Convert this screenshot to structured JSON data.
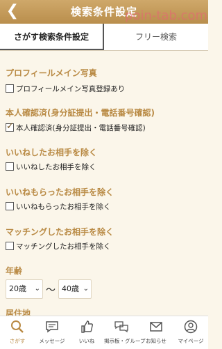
{
  "header": {
    "title": "検索条件設定",
    "watermark": "poin-tab.com"
  },
  "tabs": [
    {
      "label": "さがす検索条件設定",
      "active": true
    },
    {
      "label": "フリー検索",
      "active": false
    }
  ],
  "sections": [
    {
      "title": "プロフィールメイン写真",
      "checkbox_label": "プロフィールメイン写真登録あり",
      "checked": false
    },
    {
      "title": "本人確認済(身分証提出・電話番号確認)",
      "checkbox_label": "本人確認済(身分証提出・電話番号確認)",
      "checked": true
    },
    {
      "title": "いいねしたお相手を除く",
      "checkbox_label": "いいねしたお相手を除く",
      "checked": false
    },
    {
      "title": "いいねもらったお相手を除く",
      "checkbox_label": "いいねもらったお相手を除く",
      "checked": false
    },
    {
      "title": "マッチングしたお相手を除く",
      "checkbox_label": "マッチングしたお相手を除く",
      "checked": false
    }
  ],
  "age": {
    "title": "年齢",
    "from": "20歳",
    "separator": "〜",
    "to": "40歳"
  },
  "next_section_partial": "居住地",
  "tabbar": [
    {
      "label": "さがす",
      "icon": "search-icon",
      "active": true
    },
    {
      "label": "メッセージ",
      "icon": "message-icon",
      "active": false
    },
    {
      "label": "いいね",
      "icon": "thumbs-up-icon",
      "active": false
    },
    {
      "label": "掲示板・グループ",
      "icon": "board-icon",
      "active": false
    },
    {
      "label": "お知らせ",
      "icon": "mail-icon",
      "active": false
    },
    {
      "label": "マイページ",
      "icon": "person-icon",
      "active": false
    }
  ],
  "colors": {
    "header": "#c49a5a",
    "section_title": "#b98a44",
    "background": "#fbf6ea"
  }
}
